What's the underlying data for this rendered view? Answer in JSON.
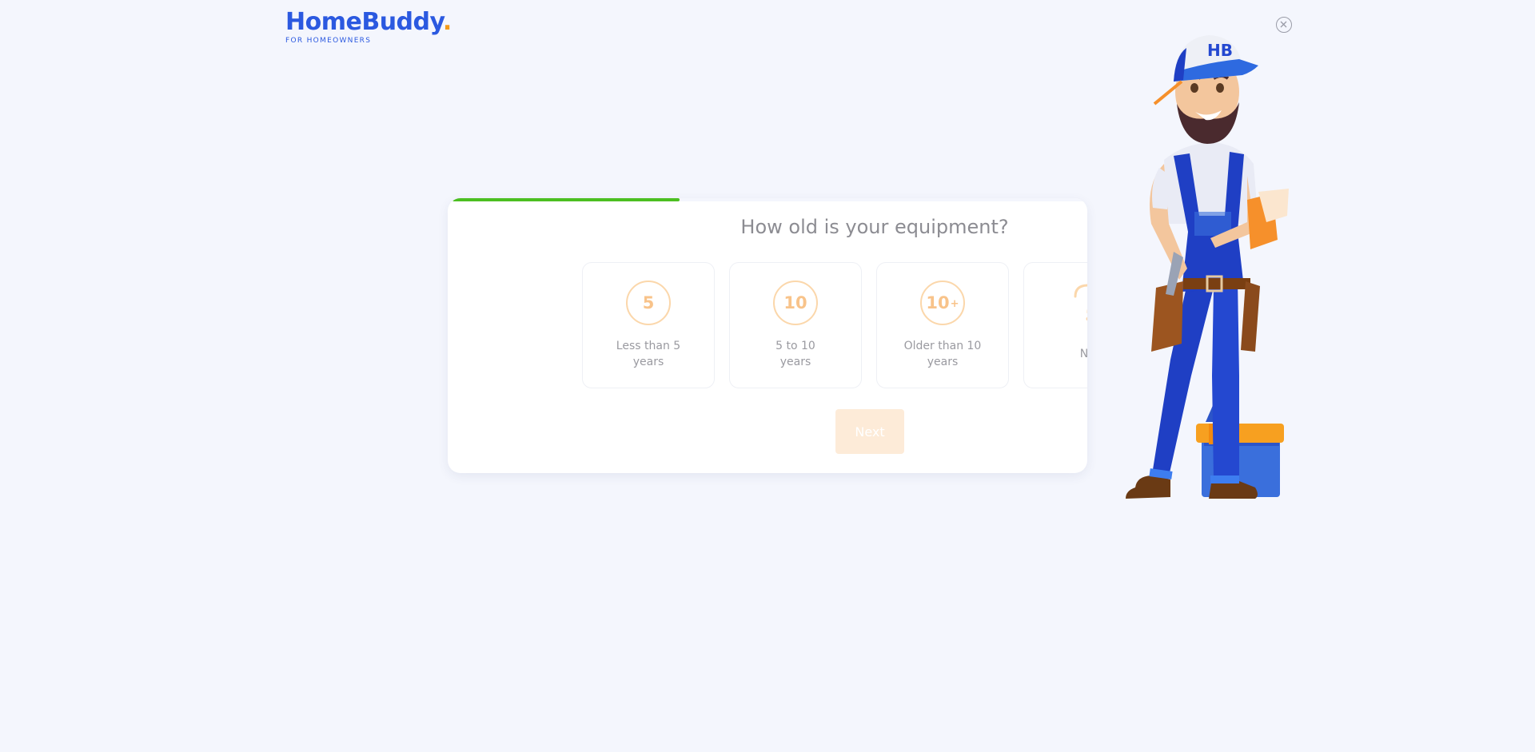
{
  "brand": {
    "name": "HomeBuddy",
    "dot": ".",
    "tagline": "FOR HOMEOWNERS",
    "accent": "#2b59e0",
    "dot_color": "#f39a1a"
  },
  "close": {
    "icon": "close-circle-icon"
  },
  "quiz": {
    "progress_fraction": 0.36,
    "progress_color": "#4cbf21",
    "question": "How old is your equipment?",
    "options": [
      {
        "badge": "5",
        "badge_suffix": "",
        "line1": "Less than 5",
        "line2": "years"
      },
      {
        "badge": "10",
        "badge_suffix": "",
        "line1": "5 to 10",
        "line2": "years"
      },
      {
        "badge": "10",
        "badge_suffix": "+",
        "line1": "Older than 10",
        "line2": "years"
      },
      {
        "badge": "",
        "badge_suffix": "",
        "line1": "Not",
        "line2": "",
        "icon": "question-mark-icon"
      }
    ],
    "next_label": "Next"
  },
  "illustration": {
    "name": "handyman-mascot-illustration",
    "cap_text": "HB"
  }
}
